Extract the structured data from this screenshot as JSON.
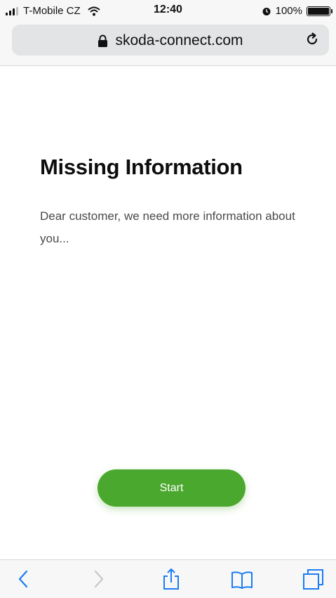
{
  "status_bar": {
    "carrier": "T-Mobile CZ",
    "time": "12:40",
    "battery": "100%"
  },
  "browser": {
    "url": "skoda-connect.com",
    "icons": [
      "lock-icon",
      "reload-icon",
      "back-icon",
      "forward-icon",
      "share-icon",
      "bookmarks-icon",
      "tabs-icon"
    ]
  },
  "page": {
    "title": "Missing Information",
    "message": "Dear customer, we need more information about you...",
    "start_label": "Start"
  },
  "colors": {
    "accent": "#4ba82e",
    "ios_blue": "#1a7cf5"
  }
}
